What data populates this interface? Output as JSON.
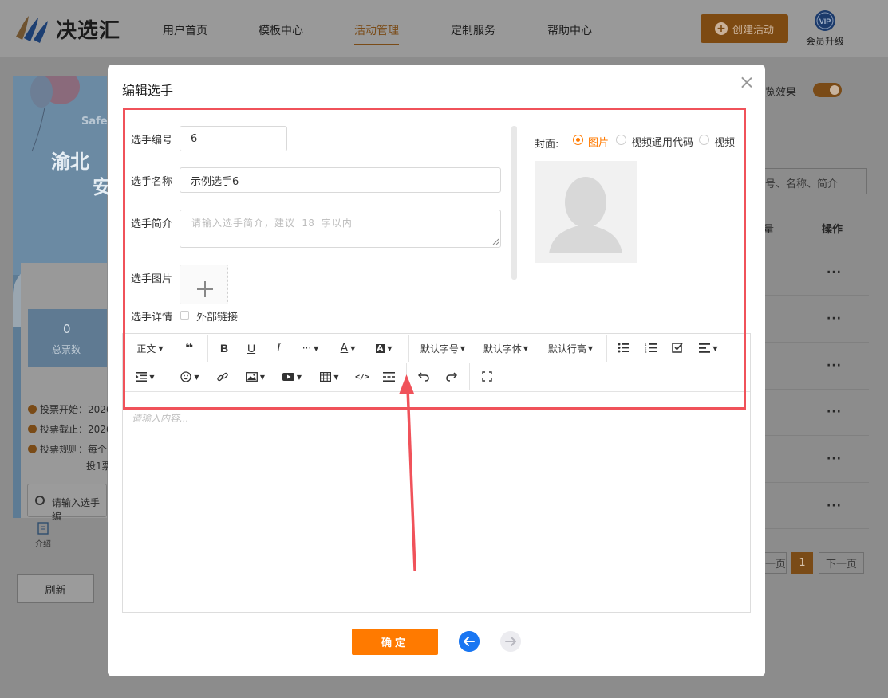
{
  "brand": {
    "name": "决选汇"
  },
  "nav": {
    "items": [
      "用户首页",
      "模板中心",
      "活动管理",
      "定制服务",
      "帮助中心"
    ],
    "active_index": 2,
    "create_label": "创建活动",
    "vip_badge": "VIP",
    "vip_label": "会员升级"
  },
  "background_left": {
    "poster_small": "Safe",
    "poster_title_1": "渝北",
    "poster_title_2": "安",
    "stat_value": "0",
    "stat_label": "总票数",
    "vote_start": "投票开始：2026",
    "vote_end": "投票截止：2026",
    "vote_rule": "投票规则：每个",
    "vote_rule_2": "投1票",
    "search_placeholder": "请输入选手编",
    "intro_tab": "介绍",
    "refresh_label": "刷新"
  },
  "background_right": {
    "preview_label": "览效果",
    "search_placeholder": "号、名称、简介",
    "column_partial": "量",
    "ops_header": "操作",
    "row_action": "···",
    "page_prev": "一页",
    "page_current": "1",
    "page_next": "下一页"
  },
  "modal": {
    "title": "编辑选手",
    "number_label": "选手编号",
    "number_value": "6",
    "name_label": "选手名称",
    "name_value": "示例选手6",
    "intro_label": "选手简介",
    "intro_placeholder": "请输入选手简介，建议 18 字以内",
    "image_label": "选手图片",
    "detail_label": "选手详情",
    "external_link_label": "外部链接",
    "cover_label": "封面:",
    "cover_options": [
      "图片",
      "视频通用代码",
      "视频"
    ],
    "cover_selected_index": 0,
    "confirm_label": "确定"
  },
  "editor": {
    "toolbar_row1": {
      "paragraph": "正文",
      "font_size": "默认字号",
      "font_family": "默认字体",
      "line_height": "默认行高",
      "more": "···",
      "font_color": "A"
    },
    "placeholder": "请输入内容..."
  },
  "colors": {
    "accent": "#ff7a00",
    "highlight": "#f0525a",
    "nav_prev": "#1976f2"
  }
}
